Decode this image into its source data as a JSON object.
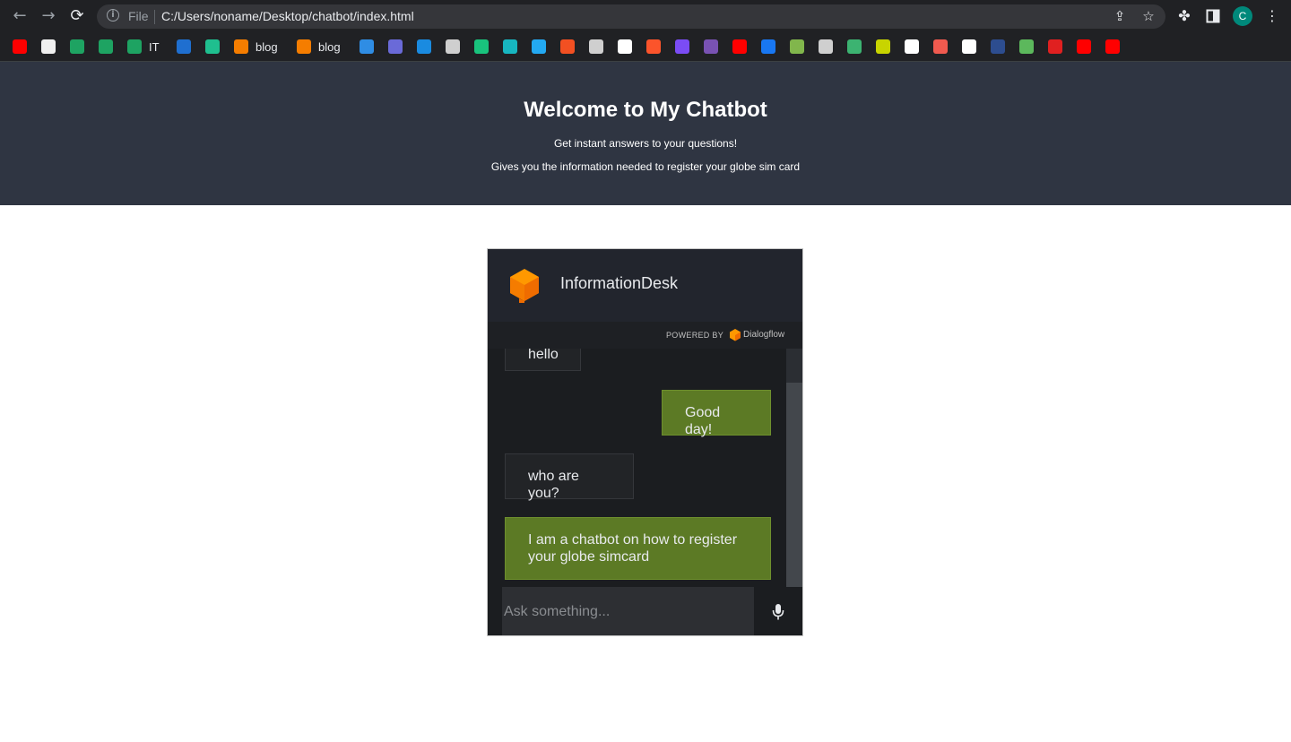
{
  "browser": {
    "omnibox": {
      "scheme_label": "File",
      "url": "C:/Users/noname/Desktop/chatbot/index.html"
    },
    "profile_initial": "C",
    "bookmarks": [
      {
        "icon": "youtube",
        "color": "#ff0000",
        "label": ""
      },
      {
        "icon": "github",
        "color": "#f0f0f0",
        "label": ""
      },
      {
        "icon": "google-drive",
        "color": "#1ea362",
        "label": ""
      },
      {
        "icon": "google-drive",
        "color": "#1ea362",
        "label": ""
      },
      {
        "icon": "google-drive",
        "color": "#1ea362",
        "label": "IT"
      },
      {
        "icon": "paypal",
        "color": "#1f6fd0",
        "label": ""
      },
      {
        "icon": "app",
        "color": "#1fbf8f",
        "label": ""
      },
      {
        "icon": "blogger",
        "color": "#f57d00",
        "label": "blog"
      },
      {
        "icon": "blogger",
        "color": "#f57d00",
        "label": "blog"
      },
      {
        "icon": "d-site",
        "color": "#2f8de4",
        "label": ""
      },
      {
        "icon": "app",
        "color": "#6a6ad8",
        "label": ""
      },
      {
        "icon": "wn",
        "color": "#1a8be0",
        "label": ""
      },
      {
        "icon": "globe",
        "color": "#cfcfcf",
        "label": ""
      },
      {
        "icon": "openai",
        "color": "#19c37d",
        "label": ""
      },
      {
        "icon": "cube",
        "color": "#17b6c0",
        "label": ""
      },
      {
        "icon": "vs-code",
        "color": "#23a9f2",
        "label": ""
      },
      {
        "icon": "microsoft",
        "color": "#f25022",
        "label": ""
      },
      {
        "icon": "globe",
        "color": "#cfcfcf",
        "label": ""
      },
      {
        "icon": "r-site",
        "color": "#ffffff",
        "label": ""
      },
      {
        "icon": "brave",
        "color": "#fb542b",
        "label": ""
      },
      {
        "icon": "app",
        "color": "#7b4cf5",
        "label": ""
      },
      {
        "icon": "bootstrap",
        "color": "#7952b3",
        "label": ""
      },
      {
        "icon": "youtube",
        "color": "#ff0000",
        "label": ""
      },
      {
        "icon": "facebook",
        "color": "#1877f2",
        "label": ""
      },
      {
        "icon": "chess",
        "color": "#81b64c",
        "label": ""
      },
      {
        "icon": "globe",
        "color": "#cfcfcf",
        "label": ""
      },
      {
        "icon": "app",
        "color": "#3cb371",
        "label": ""
      },
      {
        "icon": "x-site",
        "color": "#c8d400",
        "label": ""
      },
      {
        "icon": "app",
        "color": "#ffffff",
        "label": ""
      },
      {
        "icon": "tools",
        "color": "#f05a4f",
        "label": ""
      },
      {
        "icon": "ff",
        "color": "#ffffff",
        "label": ""
      },
      {
        "icon": "xml",
        "color": "#2d4d8f",
        "label": ""
      },
      {
        "icon": "app",
        "color": "#5cb85c",
        "label": ""
      },
      {
        "icon": "lock",
        "color": "#e02020",
        "label": ""
      },
      {
        "icon": "youtube",
        "color": "#ff0000",
        "label": ""
      },
      {
        "icon": "youtube",
        "color": "#ff0000",
        "label": ""
      }
    ]
  },
  "page": {
    "title": "Welcome to My Chatbot",
    "subtitle_1": "Get instant answers to your questions!",
    "subtitle_2": "Gives you the information needed to register your globe sim card"
  },
  "chat": {
    "agent_name": "InformationDesk",
    "powered_by": "POWERED BY",
    "powered_brand": "Dialogflow",
    "messages": [
      {
        "from": "user",
        "text": "hello"
      },
      {
        "from": "bot",
        "text": "Good day!"
      },
      {
        "from": "user",
        "text": "who are you?"
      },
      {
        "from": "bot",
        "text": "I am a chatbot on how to register your globe simcard"
      }
    ],
    "input_placeholder": "Ask something..."
  },
  "colors": {
    "header_bg": "#2f3542",
    "bot_bubble": "#5c7a25",
    "user_bubble": "#222427",
    "dialogflow_orange": "#ff9800"
  }
}
